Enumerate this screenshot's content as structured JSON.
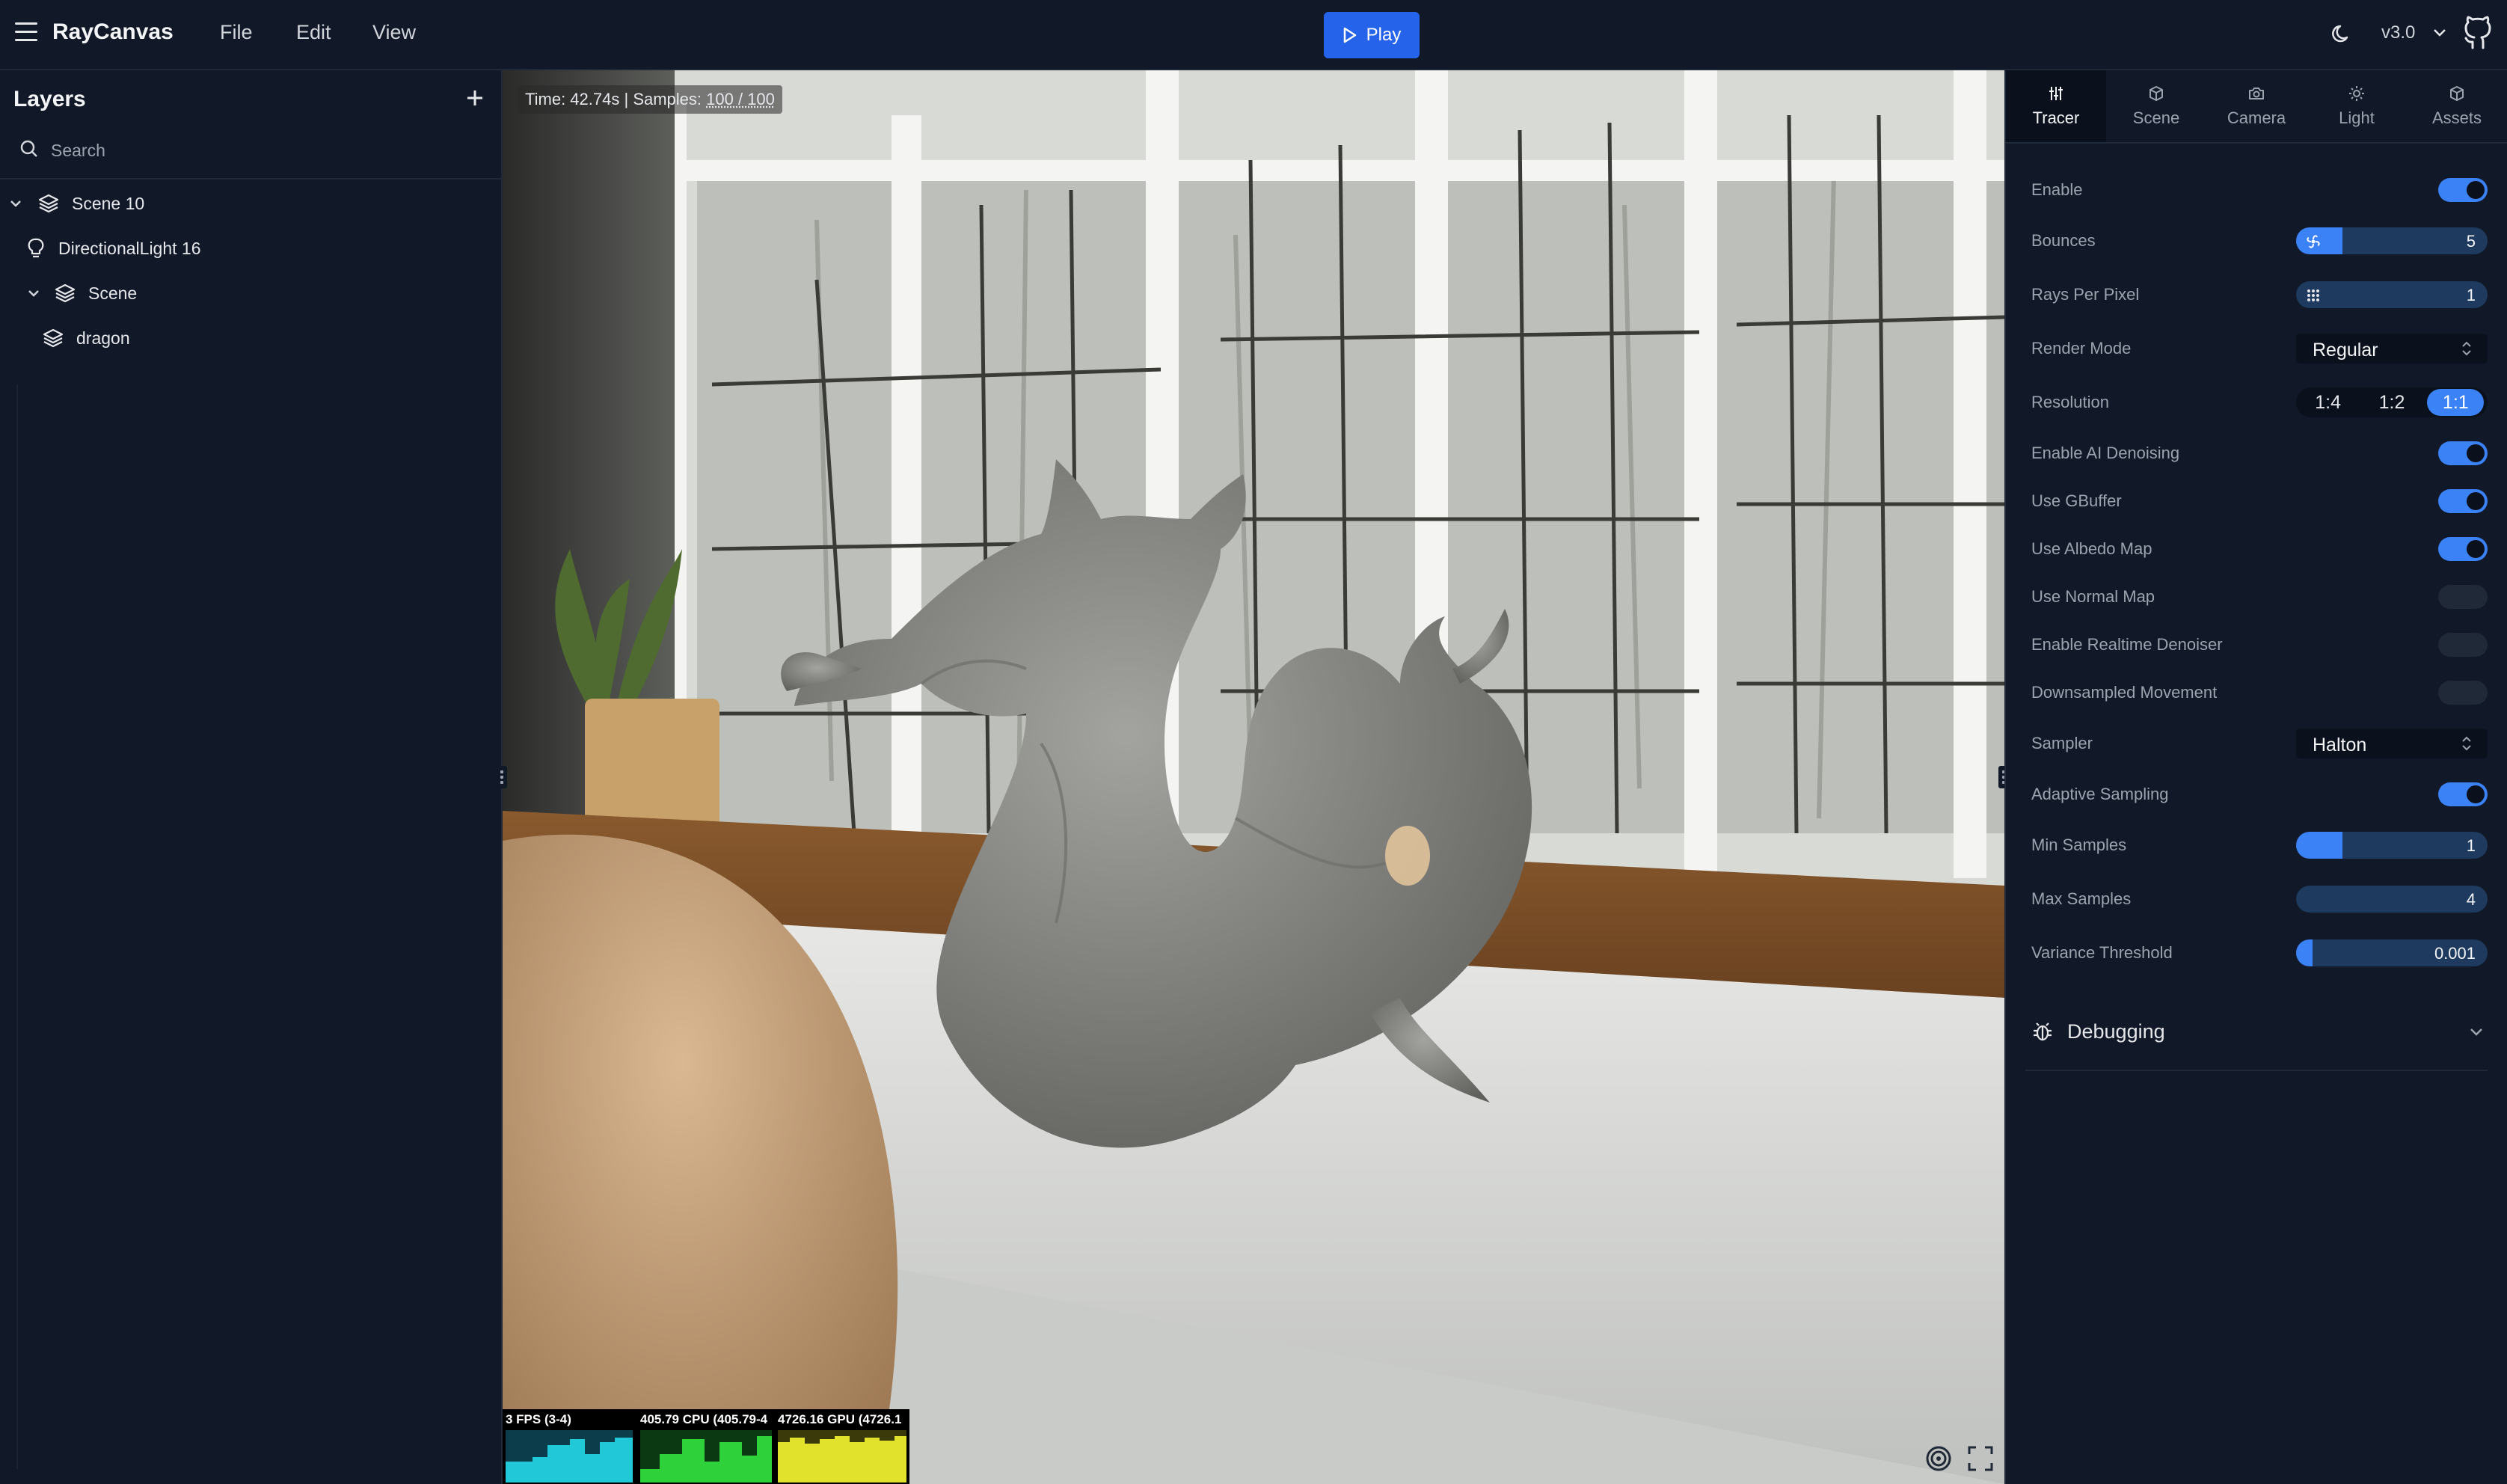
{
  "app": {
    "title": "RayCanvas",
    "version": "v3.0",
    "play_label": "Play"
  },
  "menu": {
    "file": "File",
    "edit": "Edit",
    "view": "View"
  },
  "layers": {
    "title": "Layers",
    "search_placeholder": "Search",
    "items": [
      {
        "label": "Scene 10",
        "icon": "layers-icon",
        "expanded": true
      },
      {
        "label": "DirectionalLight 16",
        "icon": "bulb-icon"
      },
      {
        "label": "Scene",
        "icon": "layers-icon",
        "expanded": true
      },
      {
        "label": "dragon",
        "icon": "layers-icon"
      }
    ]
  },
  "viewport": {
    "time_label": "Time: 42.74s |",
    "samples_label": "Samples:",
    "samples_value": "100 / 100",
    "stats": {
      "fps": "3 FPS (3-4)",
      "cpu": "405.79 CPU (405.79-4",
      "gpu": "4726.16 GPU (4726.1"
    }
  },
  "tabs": [
    {
      "label": "Tracer",
      "icon": "sliders-icon",
      "active": true
    },
    {
      "label": "Scene",
      "icon": "cube-icon"
    },
    {
      "label": "Camera",
      "icon": "camera-icon"
    },
    {
      "label": "Light",
      "icon": "sun-icon"
    },
    {
      "label": "Assets",
      "icon": "box-icon"
    }
  ],
  "tracer": {
    "enable": {
      "label": "Enable",
      "on": true
    },
    "bounces": {
      "label": "Bounces",
      "value": "5",
      "fraction": 0.12
    },
    "rays_per_pixel": {
      "label": "Rays Per Pixel",
      "value": "1",
      "fraction": 0.0
    },
    "render_mode": {
      "label": "Render Mode",
      "value": "Regular"
    },
    "resolution": {
      "label": "Resolution",
      "options": [
        "1:4",
        "1:2",
        "1:1"
      ],
      "selected": "1:1"
    },
    "ai_denoising": {
      "label": "Enable AI Denoising",
      "on": true
    },
    "gbuffer": {
      "label": "Use GBuffer",
      "on": true
    },
    "albedo": {
      "label": "Use Albedo Map",
      "on": true
    },
    "normal": {
      "label": "Use Normal Map",
      "on": false
    },
    "realtime_denoiser": {
      "label": "Enable Realtime Denoiser",
      "on": false
    },
    "downsampled": {
      "label": "Downsampled Movement",
      "on": false
    },
    "sampler": {
      "label": "Sampler",
      "value": "Halton"
    },
    "adaptive": {
      "label": "Adaptive Sampling",
      "on": true
    },
    "min_samples": {
      "label": "Min Samples",
      "value": "1",
      "fraction": 0.12
    },
    "max_samples": {
      "label": "Max Samples",
      "value": "4",
      "fraction": 0.0
    },
    "variance": {
      "label": "Variance Threshold",
      "value": "0.001",
      "fraction": 0.04
    }
  },
  "debugging": {
    "label": "Debugging"
  },
  "colors": {
    "accent": "#3b82f6",
    "panel": "#111827",
    "background": "#0b111c"
  }
}
